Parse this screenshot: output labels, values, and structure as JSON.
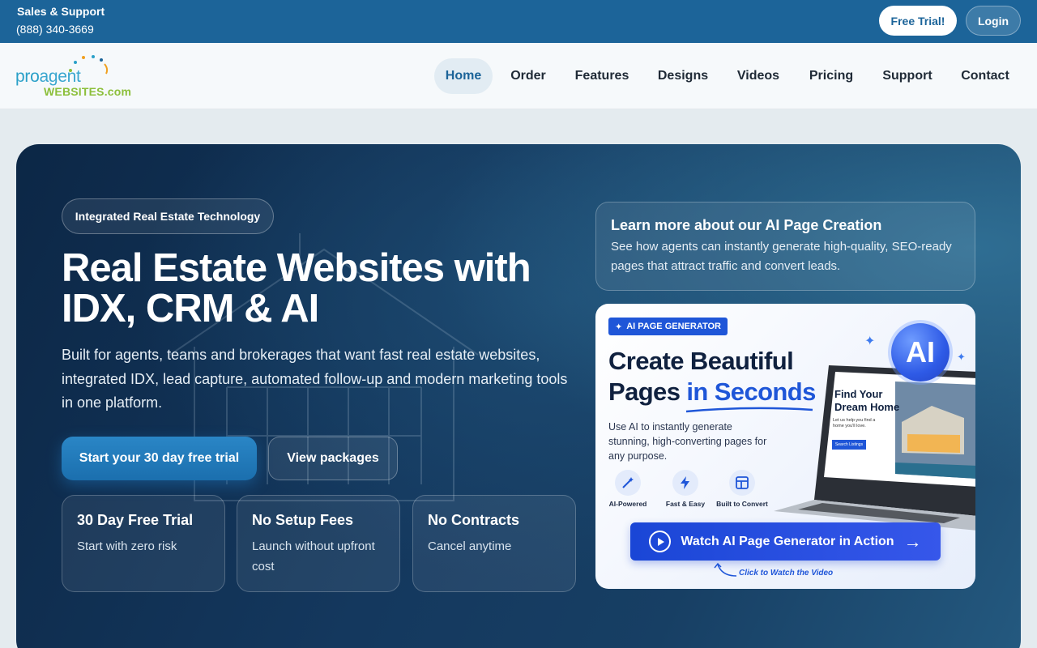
{
  "topbar": {
    "sales_label": "Sales & Support",
    "phone": "(888) 340-3669",
    "free_trial": "Free Trial!",
    "login": "Login"
  },
  "logo": {
    "part1": "pro",
    "part2": "agent",
    "part3": "WEBSITES.com"
  },
  "nav": {
    "items": [
      {
        "label": "Home",
        "active": true
      },
      {
        "label": "Order"
      },
      {
        "label": "Features"
      },
      {
        "label": "Designs"
      },
      {
        "label": "Videos"
      },
      {
        "label": "Pricing"
      },
      {
        "label": "Support"
      },
      {
        "label": "Contact"
      }
    ]
  },
  "hero": {
    "badge": "Integrated Real Estate Technology",
    "title": "Real Estate Websites with IDX, CRM & AI",
    "description": "Built for agents, teams and brokerages that want fast real estate websites, integrated IDX, lead capture, automated follow-up and modern marketing tools in one platform.",
    "cta_primary": "Start your 30 day free trial",
    "cta_secondary": "View packages",
    "features": [
      {
        "title": "30 Day Free Trial",
        "sub": "Start with zero risk"
      },
      {
        "title": "No Setup Fees",
        "sub": "Launch without upfront cost"
      },
      {
        "title": "No Contracts",
        "sub": "Cancel anytime"
      }
    ]
  },
  "learn": {
    "title": "Learn more about our AI Page Creation",
    "sub": "See how agents can instantly generate high-quality, SEO-ready pages that attract traffic and convert leads."
  },
  "ai_card": {
    "tag": "AI PAGE GENERATOR",
    "heading_line1": "Create Beautiful",
    "heading_line2a": "Pages ",
    "heading_line2b": "in Seconds",
    "paragraph": "Use AI to instantly generate stunning, high-converting pages for any purpose.",
    "circle": "AI",
    "features": [
      "AI-Powered",
      "Fast & Easy",
      "Built to Convert"
    ],
    "screen_title": "Find Your Dream Home",
    "screen_sub": "Let us help you find a home you'll love.",
    "screen_btn": "Search Listings",
    "watch": "Watch AI Page Generator in Action",
    "hint": "Click to Watch the Video",
    "colors": {
      "accent": "#1f56d8"
    }
  },
  "colors": {
    "topbar": "#1c6499",
    "hero_dark": "#0c2746"
  }
}
